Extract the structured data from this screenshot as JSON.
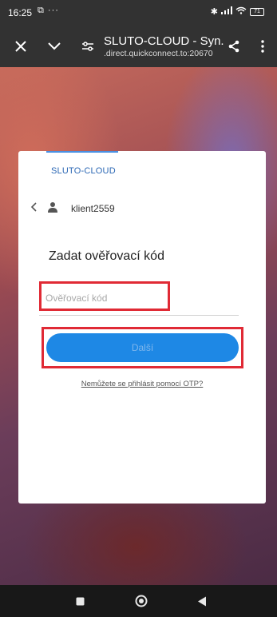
{
  "status_bar": {
    "time": "16:25",
    "left_icons": "⧉ ···",
    "battery": "71"
  },
  "app_bar": {
    "title": "SLUTO-CLOUD - Syn...",
    "url": ".direct.quickconnect.to:20670"
  },
  "login": {
    "brand": "SLUTO-CLOUD",
    "username": "klient2559",
    "heading": "Zadat ověřovací kód",
    "code_placeholder": "Ověřovací kód",
    "code_value": "",
    "next_label": "Další",
    "otp_link": "Nemůžete se přihlásit pomocí OTP?"
  },
  "colors": {
    "primary_button": "#1e88e5",
    "highlight": "#e02a35",
    "brand": "#2c68b5"
  }
}
